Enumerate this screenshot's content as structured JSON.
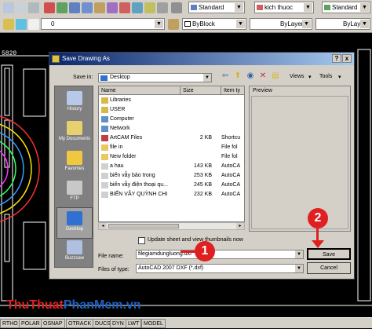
{
  "toolbar": {
    "text_style": "Standard",
    "dim_style": "kich thuoc",
    "table_style": "Standard",
    "color": "ByBlock",
    "linetype": "ByLayer",
    "lineweight": "ByLayer",
    "layer_value": "0"
  },
  "cad": {
    "coord_text": "5820"
  },
  "dialog": {
    "title": "Save Drawing As",
    "help_glyph": "?",
    "close_glyph": "x",
    "save_in_label": "Save in:",
    "save_in_value": "Desktop",
    "views_label": "Views",
    "tools_label": "Tools",
    "places": [
      {
        "label": "History",
        "color": "#b8c8e8"
      },
      {
        "label": "My Documents",
        "color": "#e8d070"
      },
      {
        "label": "Favorites",
        "color": "#f0c840"
      },
      {
        "label": "FTP",
        "color": "#c8c8c8"
      },
      {
        "label": "Desktop",
        "color": "#3070d0"
      },
      {
        "label": "Buzzsaw",
        "color": "#b0c0e0"
      }
    ],
    "columns": {
      "name": "Name",
      "size": "Size",
      "type": "Item ty"
    },
    "files": [
      {
        "name": "Libraries",
        "size": "",
        "type": "",
        "icon": "#d8b848"
      },
      {
        "name": "USER",
        "size": "",
        "type": "",
        "icon": "#d8b848"
      },
      {
        "name": "Computer",
        "size": "",
        "type": "",
        "icon": "#6090c8"
      },
      {
        "name": "Network",
        "size": "",
        "type": "",
        "icon": "#6090c8"
      },
      {
        "name": "ArtCAM Files",
        "size": "2 KB",
        "type": "Shortcu",
        "icon": "#c04040"
      },
      {
        "name": "file in",
        "size": "",
        "type": "File fol",
        "icon": "#e8c860"
      },
      {
        "name": "New folder",
        "size": "",
        "type": "File fol",
        "icon": "#e8c860"
      },
      {
        "name": "a hau",
        "size": "143 KB",
        "type": "AutoCA",
        "icon": "#d0d0d0"
      },
      {
        "name": "biến vẫy bảo trong",
        "size": "253 KB",
        "type": "AutoCA",
        "icon": "#d0d0d0"
      },
      {
        "name": "biến vẫy điện thoại qu...",
        "size": "245 KB",
        "type": "AutoCA",
        "icon": "#d0d0d0"
      },
      {
        "name": "BIẾN VẪY QUỲNH CHI",
        "size": "232 KB",
        "type": "AutoCA",
        "icon": "#d0d0d0"
      }
    ],
    "preview_label": "Preview",
    "update_label": "Update sheet and view thumbnails now",
    "filename_label": "File name:",
    "filename_value": "filegiamdungluong.dxf",
    "filetype_label": "Files of type:",
    "filetype_value": "AutoCAD 2007 DXF (*.dxf)",
    "save_button": "Save",
    "cancel_button": "Cancel"
  },
  "callouts": {
    "one": "1",
    "two": "2"
  },
  "watermark": {
    "part1": "ThuThuat",
    "part2": "PhanMem",
    "part3": ".vn",
    "color1": "#e02020",
    "color2": "#1e60c0"
  },
  "status_bar": [
    "RTHO",
    "POLAR",
    "OSNAP",
    "OTRACK",
    "DUCS",
    "DYN",
    "LWT",
    "MODEL"
  ]
}
